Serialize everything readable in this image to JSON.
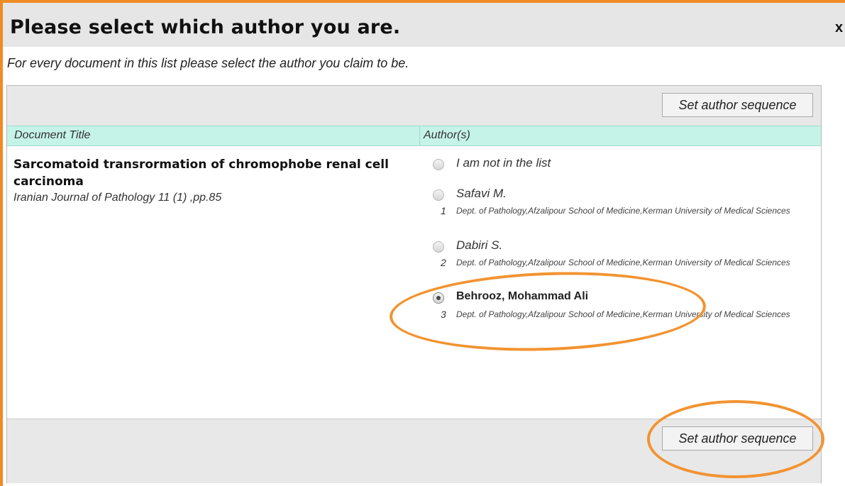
{
  "dialog": {
    "title": "Please select which author you are.",
    "close": "x",
    "subtitle": "For every document in this list please select the author you claim to be."
  },
  "buttons": {
    "set_sequence_top": "Set author sequence",
    "set_sequence_bottom": "Set author sequence"
  },
  "table": {
    "columns": [
      "Document Title",
      "Author(s)"
    ],
    "document": {
      "title": "Sarcomatoid transrormation of chromophobe renal cell carcinoma",
      "journal": "Iranian Journal of Pathology 11 (1) ,pp.85"
    },
    "authors": [
      {
        "name": "I am not in the list",
        "number": "",
        "affiliation": "",
        "selected": false
      },
      {
        "name": "Safavi M.",
        "number": "1",
        "affiliation": "Dept. of Pathology,Afzalipour School of Medicine,Kerman University of Medical Sciences",
        "selected": false
      },
      {
        "name": "Dabiri S.",
        "number": "2",
        "affiliation": "Dept. of Pathology,Afzalipour School of Medicine,Kerman University of Medical Sciences",
        "selected": false
      },
      {
        "name": "Behrooz, Mohammad Ali",
        "number": "3",
        "affiliation": "Dept. of Pathology,Afzalipour School of Medicine,Kerman University of Medical Sciences",
        "selected": true
      }
    ]
  },
  "colors": {
    "frame_accent": "#f08a24",
    "header_row": "#c6f3e8",
    "panel_gray": "#e8e8e8",
    "highlight": "#f29330"
  }
}
